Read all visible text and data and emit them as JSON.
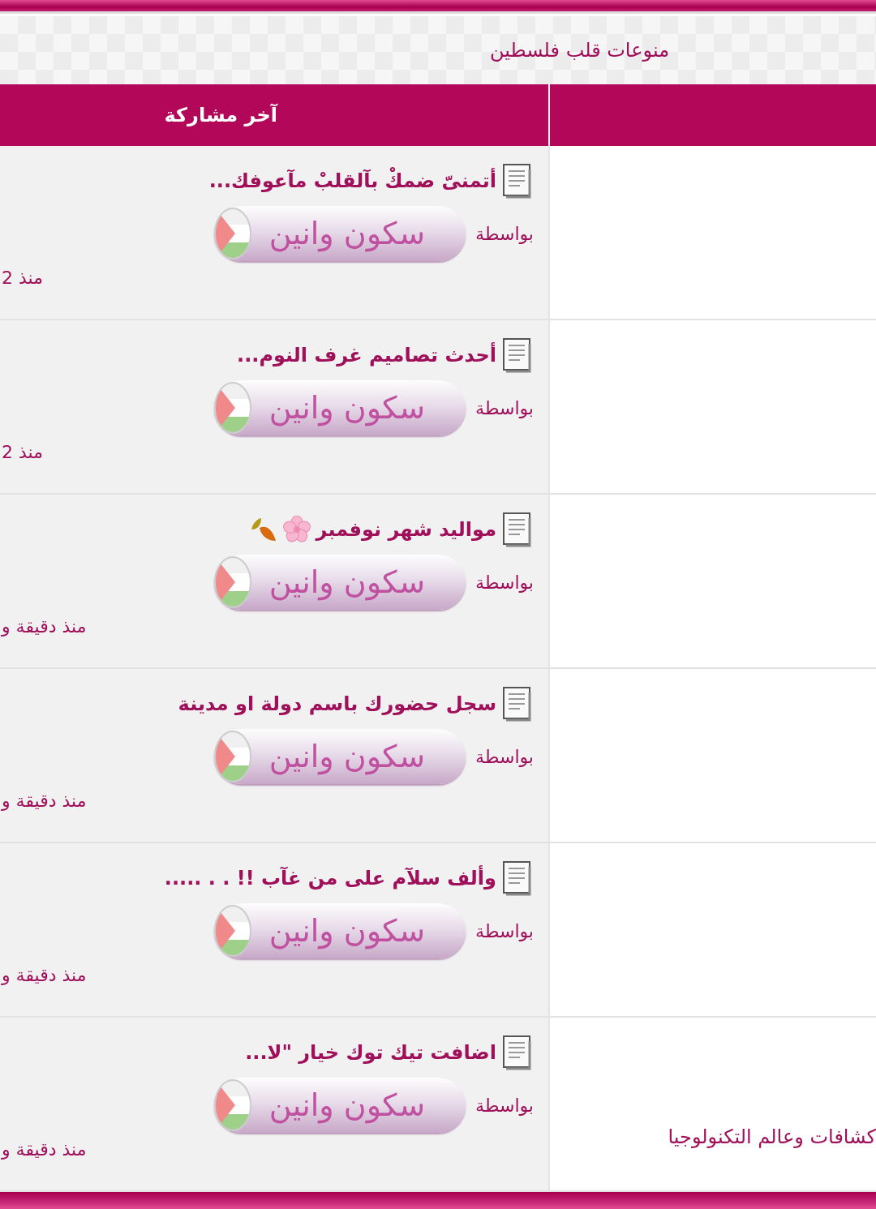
{
  "section": {
    "title": "منوعات قلب فلسطين"
  },
  "table": {
    "columns": [
      "آخر مشاركة"
    ],
    "rows": [
      {
        "kind": "plain",
        "title": "أتمنىّ ضمكْ بآلقلبْ مآعوفك...",
        "by_label": "بواسطة",
        "username": "سكون وانين",
        "time": "منذ 2"
      },
      {
        "kind": "plain",
        "title": "أحدث تصاميم غرف النوم...",
        "by_label": "بواسطة",
        "username": "سكون وانين",
        "time": "منذ 2"
      },
      {
        "kind": "decorated",
        "title": "مواليد شهر نوفمبر",
        "by_label": "بواسطة",
        "username": "سكون وانين",
        "time": "منذ دقيقة و"
      },
      {
        "kind": "plain",
        "title": "سجل حضورك باسم دولة او مدينة",
        "by_label": "بواسطة",
        "username": "سكون وانين",
        "time": "منذ دقيقة و"
      },
      {
        "kind": "plain",
        "title": "وألف سلآم على من غآب !! . . .....",
        "by_label": "بواسطة",
        "username": "سكون وانين",
        "time": "منذ دقيقة و"
      },
      {
        "kind": "plain",
        "title": "اضافت تيك توك خيار \"لا...",
        "by_label": "بواسطة",
        "username": "سكون وانين",
        "time": "منذ دقيقة و",
        "forum": "كشافات وعالم التكنولوجيا"
      }
    ]
  }
}
